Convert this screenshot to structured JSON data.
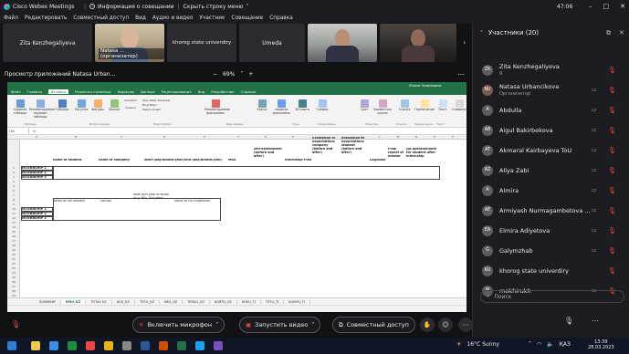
{
  "titlebar": {
    "app_name": "Cisco Webex Meetings",
    "info_label": "Информация о совещании",
    "hide_menu": "Скрыть строку меню",
    "time": "47:06"
  },
  "menubar": [
    "Файл",
    "Редактировать",
    "Совместный доступ",
    "Вид",
    "Аудио и видео",
    "Участник",
    "Совещание",
    "Справка"
  ],
  "video_tiles": [
    {
      "name": "Zita Kenzhegaliyeva",
      "type": "name"
    },
    {
      "name": "Natasa ... (организатор)",
      "type": "video"
    },
    {
      "name": "khorog state univerdiry",
      "type": "name"
    },
    {
      "name": "Umeda",
      "type": "name"
    },
    {
      "name": "",
      "type": "video2"
    },
    {
      "name": "",
      "type": "video3"
    }
  ],
  "share": {
    "title": "Просмотр приложений Natasa Urban...",
    "zoom": "69%",
    "minus": "−",
    "plus": "+"
  },
  "excel": {
    "user": "Zhanar Amanbaeva",
    "tabs": [
      "Файл",
      "Главная",
      "Вставка",
      "Разметка страницы",
      "Формулы",
      "Данные",
      "Рецензирование",
      "Вид",
      "Разработчик",
      "Справка"
    ],
    "active_tab": "Вставка",
    "name_box": "I16",
    "fx": "fx",
    "ribbon_items": [
      "Сводная таблица",
      "Рекомендуемые сводные таблицы",
      "Таблица",
      "Рисунки",
      "Фигуры",
      "Значки",
      "3D-модели",
      "SmartArt",
      "Снимок",
      "Надстройки",
      "Рекомендуемые диаграммы",
      "Карты",
      "Сводная диаграмма",
      "3D-карта",
      "График",
      "Гистограмма",
      "Выигрыш/проигрыш",
      "Срез",
      "Временная шкала",
      "Ссылка",
      "Примечание",
      "Текст",
      "Символы"
    ],
    "ribbon_addins": [
      "Visio Data Visualizer",
      "Bing Maps",
      "People Graph",
      "Получить надстройки",
      "Мои надстройки"
    ],
    "ribbon_groups": [
      "Таблицы",
      "Иллюстрации",
      "Надстройки",
      "Диаграммы",
      "Туры",
      "Спарклайны",
      "Фильтры",
      "Ссылки",
      "Примечания",
      "Текст",
      "Символы"
    ],
    "columns": [
      "A",
      "B",
      "C",
      "D",
      "E",
      "F",
      "G",
      "H",
      "I",
      "J",
      "K",
      "L",
      "M",
      "N",
      "O",
      "P",
      "Q",
      "R",
      "S"
    ],
    "rows": [
      "1",
      "2",
      "3",
      "4",
      "5",
      "6",
      "7",
      "8",
      "9",
      "10",
      "11",
      "12",
      "13",
      "14",
      "15",
      "16",
      "17",
      "18",
      "19",
      "20",
      "21",
      "22",
      "23",
      "24",
      "25",
      "26",
      "27",
      "28",
      "29",
      "30",
      "31",
      "32",
      "33",
      "34",
      "35",
      "36"
    ],
    "header1": {
      "name": "name of student",
      "company": "name of company",
      "start": "start (day/month/year)",
      "end": "end (day/month/year)",
      "mob": "MoU",
      "self": "self-assessment (before and after)",
      "plan": "Internship  Plan",
      "eval_company": "Evaluation of expectations company (before and after)",
      "eval_student": "Evaluation of expectations student (before and after)",
      "logbook": "Log/book",
      "final": "Final report of mentor",
      "qa": "QA questionnaire for student  after internship"
    },
    "block1_rows": [
      "INTERNSHIP 1",
      "INTERNSHIP 2",
      "INTERNSHIP 3"
    ],
    "header2": {
      "student": "Name of the student",
      "faculty": "Faculty",
      "level": "level and year of study (e.g. BSc, 3rd year)",
      "supervisor": "name of HEI supervisor"
    },
    "block2_rows": [
      "INTERNSHIP 1",
      "INTERNSHIP 2",
      "INTERNSHIP 3"
    ],
    "sheets": [
      "SUMMARY",
      "EMU_KZ",
      "TOTAL KZ",
      "AGU_KZ",
      "TSTU_KZ",
      "NKS_UZ",
      "TERSU_UZ",
      "AGRTU_UZ",
      "KHSU_TJ",
      "TSTU_TJ",
      "KUEMS_TJ"
    ],
    "active_sheet": "EMU_KZ"
  },
  "controls": {
    "mic": "Включить микрофон",
    "video": "Запустить видео",
    "share": "Совместный доступ"
  },
  "panel": {
    "title": "Участники (20)",
    "search_placeholder": "Поиск",
    "participants": [
      {
        "initials": "ZK",
        "name": "Zita Kenzhegaliyeva",
        "role": "Я",
        "cam": false
      },
      {
        "initials": "NU",
        "name": "Natasa Urbancikova",
        "role": "Организатор",
        "cam": true
      },
      {
        "initials": "A",
        "name": "Abdulla",
        "role": "",
        "cam": true
      },
      {
        "initials": "AB",
        "name": "Aigul Bakirbekova",
        "role": "",
        "cam": true
      },
      {
        "initials": "AT",
        "name": "Akmaral Kairbayeva ToU",
        "role": "",
        "cam": true
      },
      {
        "initials": "AZ",
        "name": "Aliya Zabi",
        "role": "",
        "cam": true
      },
      {
        "initials": "A",
        "name": "Almira",
        "role": "",
        "cam": true
      },
      {
        "initials": "AE",
        "name": "Armiyash Nurmagambetova ...",
        "role": "",
        "cam": true
      },
      {
        "initials": "EA",
        "name": "Elmira Adiyetova",
        "role": "",
        "cam": true
      },
      {
        "initials": "G",
        "name": "Galymzhab",
        "role": "",
        "cam": true
      },
      {
        "initials": "KU",
        "name": "khorog state univerdiry",
        "role": "",
        "cam": false
      },
      {
        "initials": "M",
        "name": "mokhirukh",
        "role": "",
        "cam": true
      }
    ]
  },
  "taskbar": {
    "weather": "16°C  Sunny",
    "lang": "ҚАЗ",
    "time": "13:39",
    "date": "28.03.2023"
  },
  "colors": {
    "excel_green": "#217346",
    "mute_red": "#e44444",
    "end_red": "#e0262c"
  }
}
